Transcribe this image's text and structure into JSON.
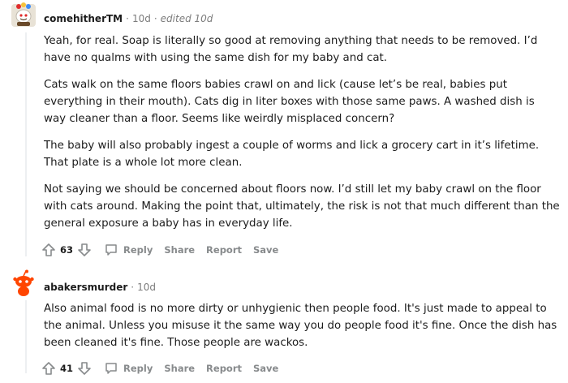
{
  "comments": [
    {
      "author": "comehitherTM",
      "time": "10d",
      "edited": "edited 10d",
      "paragraphs": [
        "Yeah, for real. Soap is literally so good at removing anything that needs to be removed. I’d have no qualms with using the same dish for my baby and cat.",
        "Cats walk on the same floors babies crawl on and lick (cause let’s be real, babies put everything in their mouth). Cats dig in liter boxes with those same paws. A washed dish is way cleaner than a floor. Seems like weirdly misplaced concern?",
        "The baby will also probably ingest a couple of worms and lick a grocery cart in it’s lifetime. That plate is a whole lot more clean.",
        "Not saying we should be concerned about floors now. I’d still let my baby crawl on the floor with cats around. Making the point that, ultimately, the risk is not that much different than the general exposure a baby has in everyday life."
      ],
      "votes": "63",
      "actions": {
        "reply": "Reply",
        "share": "Share",
        "report": "Report",
        "save": "Save"
      }
    },
    {
      "author": "abakersmurder",
      "time": "10d",
      "paragraphs": [
        "Also animal food is no more dirty or unhygienic then people food. It's just made to appeal to the animal. Unless you misuse it the same way you do people food it's fine. Once the dish has been cleaned it's fine. Those people are wackos."
      ],
      "votes": "41",
      "actions": {
        "reply": "Reply",
        "share": "Share",
        "report": "Report",
        "save": "Save"
      }
    }
  ],
  "colors": {
    "meta": "#7c7c7c",
    "action": "#878a8c",
    "thread": "#edeff1",
    "snoo": "#ff4500"
  }
}
